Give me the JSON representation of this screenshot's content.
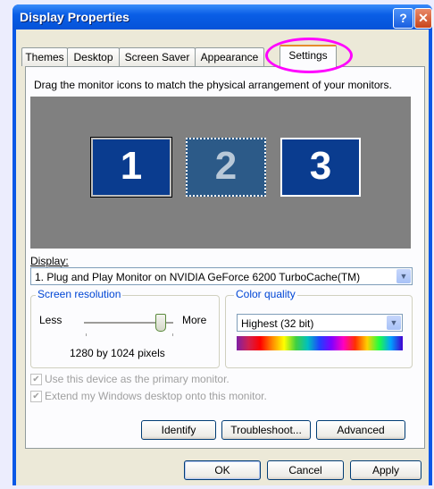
{
  "window": {
    "title": "Display Properties",
    "help_glyph": "?",
    "close_glyph": "✕"
  },
  "tabs": [
    {
      "label": "Themes"
    },
    {
      "label": "Desktop"
    },
    {
      "label": "Screen Saver"
    },
    {
      "label": "Appearance"
    },
    {
      "label": "Settings"
    }
  ],
  "active_tab": "Settings",
  "settings": {
    "instruction": "Drag the monitor icons to match the physical arrangement of your monitors.",
    "monitors": [
      {
        "label": "1"
      },
      {
        "label": "2"
      },
      {
        "label": "3"
      }
    ],
    "display_label": "Display:",
    "display_value": "1. Plug and Play Monitor on NVIDIA GeForce 6200 TurboCache(TM)",
    "resolution": {
      "group_label": "Screen resolution",
      "less": "Less",
      "more": "More",
      "value_text": "1280 by 1024 pixels",
      "slider_level": 0.85
    },
    "color_quality": {
      "group_label": "Color quality",
      "value": "Highest (32 bit)"
    },
    "primary_checkbox": "Use this device as the primary monitor.",
    "extend_checkbox": "Extend my Windows desktop onto this monitor.",
    "identify": "Identify",
    "troubleshoot": "Troubleshoot...",
    "advanced": "Advanced"
  },
  "footer": {
    "ok": "OK",
    "cancel": "Cancel",
    "apply": "Apply"
  },
  "colors": {
    "titlebar": "#0a5ee6",
    "face": "#ece9d8",
    "highlight_ring": "#ff00ff"
  }
}
